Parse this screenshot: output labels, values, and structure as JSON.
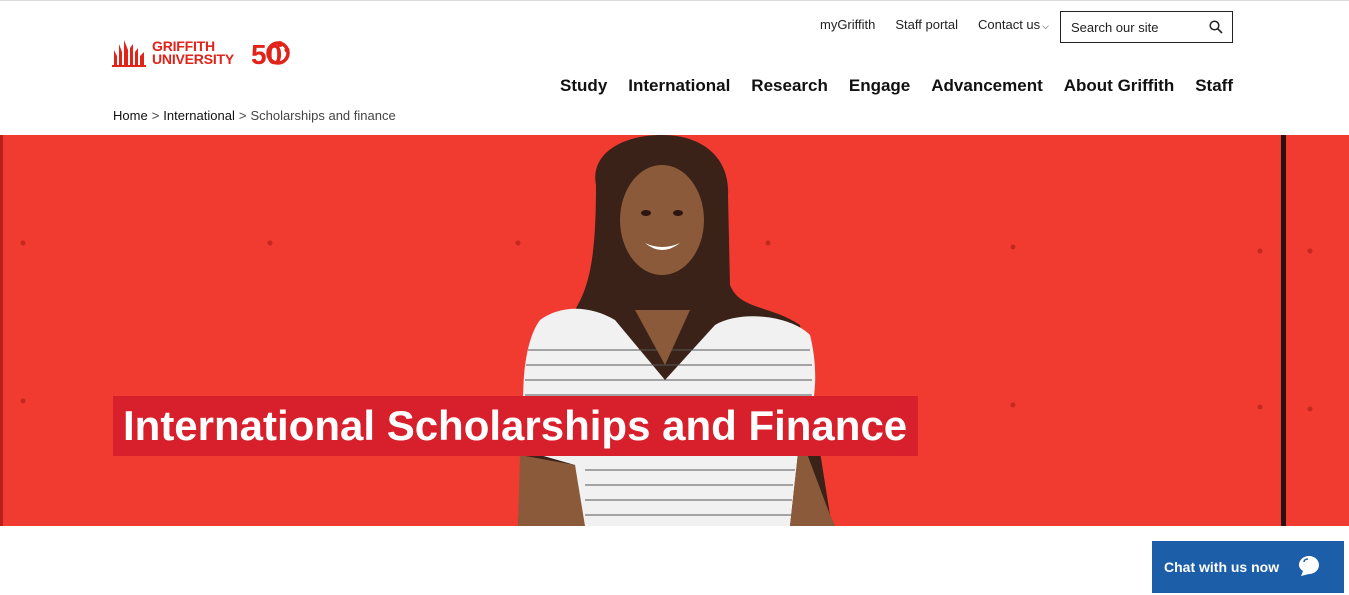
{
  "header": {
    "logo_text_line1": "GRIFFITH",
    "logo_text_line2": "UNIVERSITY",
    "anniversary": "50",
    "utility_links": {
      "my_griffith": "myGriffith",
      "staff_portal": "Staff portal",
      "contact_us": "Contact us"
    },
    "search": {
      "placeholder": "Search our site"
    },
    "nav": {
      "study": "Study",
      "international": "International",
      "research": "Research",
      "engage": "Engage",
      "advancement": "Advancement",
      "about": "About Griffith",
      "staff": "Staff"
    }
  },
  "breadcrumb": {
    "home": "Home",
    "international": "International",
    "current": "Scholarships and finance",
    "separator": ">"
  },
  "hero": {
    "title": "International Scholarships and Finance",
    "background_color": "#f23b30",
    "title_bg_color": "#d8202c"
  },
  "chat": {
    "label": "Chat with us now",
    "icon": "chat-bubble-icon",
    "color": "#1d5ea8"
  },
  "brand_color": "#e2231a"
}
